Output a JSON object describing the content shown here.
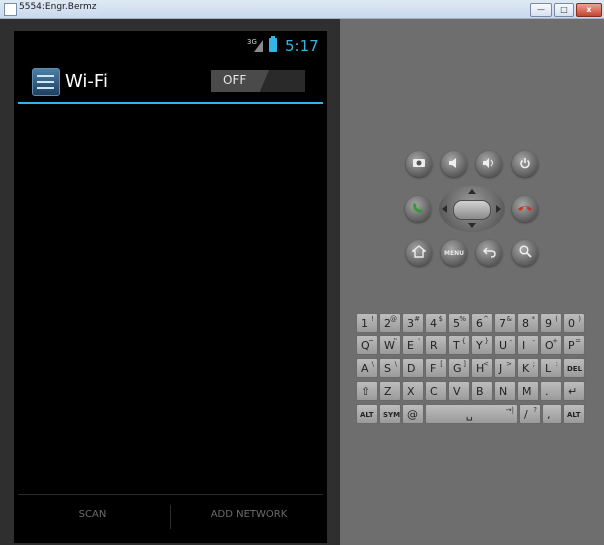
{
  "window": {
    "title": "5554:Engr.Bermz",
    "min_label": "—",
    "max_label": "□",
    "close_label": "x"
  },
  "status_bar": {
    "network": "3G",
    "time": "5:17",
    "battery_color": "#33b5e5"
  },
  "action_bar": {
    "title": "Wi-Fi",
    "toggle_label": "OFF",
    "accent": "#33b5e5"
  },
  "bottom_bar": {
    "scan_label": "SCAN",
    "add_network_label": "ADD NETWORK"
  },
  "hardware_buttons": {
    "camera": "camera-icon",
    "volume_down": "volume-down-icon",
    "volume_up": "volume-up-icon",
    "power": "power-icon",
    "call": "call-icon",
    "end_call": "end-call-icon",
    "home": "home-icon",
    "menu_label": "MENU",
    "back": "back-icon",
    "search": "search-icon"
  },
  "keyboard": {
    "row1": [
      {
        "m": "1",
        "s": "!"
      },
      {
        "m": "2",
        "s": "@"
      },
      {
        "m": "3",
        "s": "#"
      },
      {
        "m": "4",
        "s": "$"
      },
      {
        "m": "5",
        "s": "%"
      },
      {
        "m": "6",
        "s": "^"
      },
      {
        "m": "7",
        "s": "&"
      },
      {
        "m": "8",
        "s": "*"
      },
      {
        "m": "9",
        "s": "("
      },
      {
        "m": "0",
        "s": ")"
      }
    ],
    "row2": [
      {
        "m": "Q",
        "s": "~"
      },
      {
        "m": "W",
        "s": "\""
      },
      {
        "m": "E",
        "s": "'"
      },
      {
        "m": "R",
        "s": ""
      },
      {
        "m": "T",
        "s": "{"
      },
      {
        "m": "Y",
        "s": "}"
      },
      {
        "m": "U",
        "s": "-"
      },
      {
        "m": "I",
        "s": "-"
      },
      {
        "m": "O",
        "s": "+"
      },
      {
        "m": "P",
        "s": "="
      }
    ],
    "row3": [
      {
        "m": "A",
        "s": "\\"
      },
      {
        "m": "S",
        "s": "\\"
      },
      {
        "m": "D",
        "s": ""
      },
      {
        "m": "F",
        "s": "["
      },
      {
        "m": "G",
        "s": "]"
      },
      {
        "m": "H",
        "s": "<"
      },
      {
        "m": "J",
        "s": ">"
      },
      {
        "m": "K",
        "s": ";"
      },
      {
        "m": "L",
        "s": ":"
      },
      {
        "m": "DEL",
        "s": ""
      }
    ],
    "row4": [
      {
        "m": "⇧",
        "s": ""
      },
      {
        "m": "Z",
        "s": ""
      },
      {
        "m": "X",
        "s": ""
      },
      {
        "m": "C",
        "s": ""
      },
      {
        "m": "V",
        "s": ""
      },
      {
        "m": "B",
        "s": ""
      },
      {
        "m": "N",
        "s": ""
      },
      {
        "m": "M",
        "s": ""
      },
      {
        "m": ".",
        "s": ""
      },
      {
        "m": "↵",
        "s": ""
      }
    ],
    "row5": [
      {
        "m": "ALT",
        "s": ""
      },
      {
        "m": "SYM",
        "s": ""
      },
      {
        "m": "@",
        "s": ""
      },
      {
        "m": "␣",
        "s": "→|"
      },
      {
        "m": "/",
        "s": "?"
      },
      {
        "m": ",",
        "s": ""
      },
      {
        "m": "ALT",
        "s": ""
      }
    ]
  }
}
